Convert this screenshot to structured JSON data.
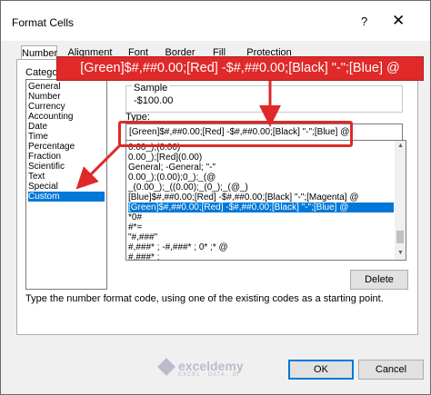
{
  "window": {
    "title": "Format Cells",
    "help_label": "?",
    "close_label": "✕"
  },
  "tabs": [
    {
      "label": "Number",
      "active": true
    },
    {
      "label": "Alignment",
      "active": false
    },
    {
      "label": "Font",
      "active": false
    },
    {
      "label": "Border",
      "active": false
    },
    {
      "label": "Fill",
      "active": false
    },
    {
      "label": "Protection",
      "active": false
    }
  ],
  "category": {
    "label": "Categor",
    "items": [
      "General",
      "Number",
      "Currency",
      "Accounting",
      "Date",
      "Time",
      "Percentage",
      "Fraction",
      "Scientific",
      "Text",
      "Special",
      "Custom"
    ],
    "selected": "Custom"
  },
  "sample": {
    "label": "Sample",
    "value": "-$100.00"
  },
  "type": {
    "label": "Type:",
    "value": "[Green]$#,##0.00;[Red] -$#,##0.00;[Black] \"-\";[Blue] @"
  },
  "format_list": {
    "items": [
      "0.00_);(0.00)",
      "0.00_);[Red](0.00)",
      "General; -General; \"-\"",
      "0.00_);(0.00);0_);_(@",
      "_(0.00_);_((0.00);_(0_);_(@_)",
      "[Blue]$#,##0.00;[Red] -$#,##0.00;[Black] \"-\";[Magenta] @",
      "[Green]$#,##0.00;[Red] -$#,##0.00;[Black] \"-\";[Blue] @",
      "*0#",
      "#*=",
      "\"#,###\"",
      "#,###* ; -#,###* ; 0* ;* @",
      "#,###* ;"
    ],
    "selected_index": 6
  },
  "buttons": {
    "delete": "Delete",
    "ok": "OK",
    "cancel": "Cancel"
  },
  "hint": "Type the number format code, using one of the existing codes as a starting point.",
  "callout": {
    "text": "[Green]$#,##0.00;[Red] -$#,##0.00;[Black] \"-\";[Blue] @",
    "color": "#e02929"
  },
  "watermark": {
    "name": "exceldemy",
    "tagline": "EXCEL · DATA · BI"
  },
  "colors": {
    "selection": "#0078d7",
    "annotation": "#e02929"
  }
}
